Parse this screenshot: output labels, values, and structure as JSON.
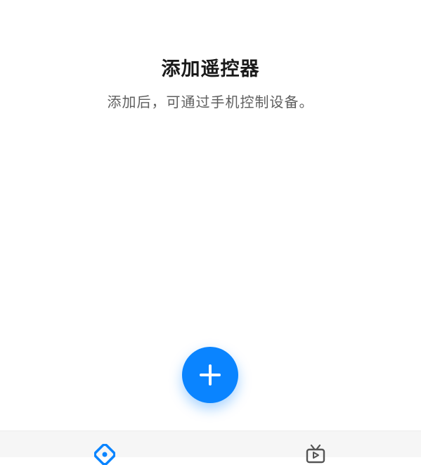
{
  "header": {
    "title": "添加遥控器",
    "subtitle": "添加后，可通过手机控制设备。"
  },
  "fab": {
    "icon": "plus-icon",
    "color": "#0a84ff"
  },
  "bottom_nav": {
    "items": [
      {
        "icon": "remote-control-icon",
        "active": true,
        "color": "#0a84ff"
      },
      {
        "icon": "tv-icon",
        "active": false,
        "color": "#555555"
      }
    ]
  }
}
